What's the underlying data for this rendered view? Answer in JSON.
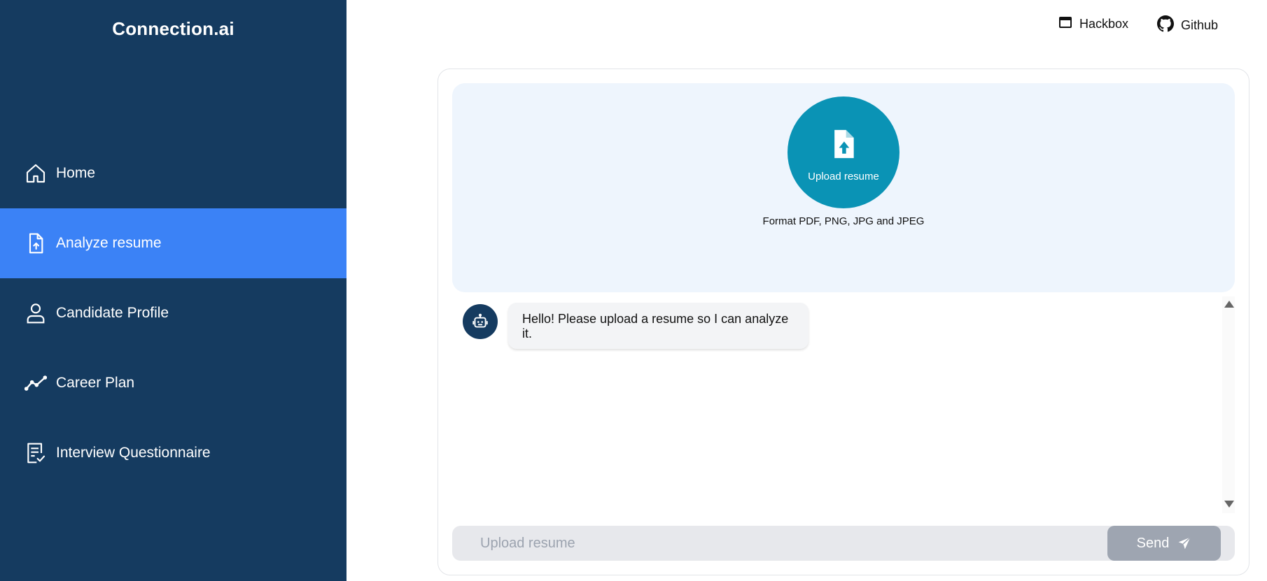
{
  "app": {
    "brand": "Connection.ai"
  },
  "nav": {
    "items": [
      {
        "label": "Home",
        "icon": "home-icon"
      },
      {
        "label": "Analyze resume",
        "icon": "file-upload-icon",
        "active": true
      },
      {
        "label": "Candidate Profile",
        "icon": "user-icon"
      },
      {
        "label": "Career Plan",
        "icon": "trend-line-icon"
      },
      {
        "label": "Interview Questionnaire",
        "icon": "checklist-icon"
      }
    ]
  },
  "header": {
    "links": [
      {
        "label": "Hackbox",
        "icon": "window-icon"
      },
      {
        "label": "Github",
        "icon": "github-icon"
      }
    ]
  },
  "upload": {
    "button_label": "Upload resume",
    "format_text": "Format PDF, PNG, JPG and JPEG"
  },
  "chat": {
    "messages": [
      {
        "sender": "bot",
        "text": "Hello! Please upload a resume so I can analyze it."
      }
    ]
  },
  "composer": {
    "placeholder": "Upload resume",
    "send_label": "Send"
  },
  "colors": {
    "sidebar": "#153b60",
    "active_nav": "#3b82f6",
    "upload_circle": "#0a93b5",
    "upload_zone": "#eef5fd",
    "send_button": "#9ea5b1"
  }
}
